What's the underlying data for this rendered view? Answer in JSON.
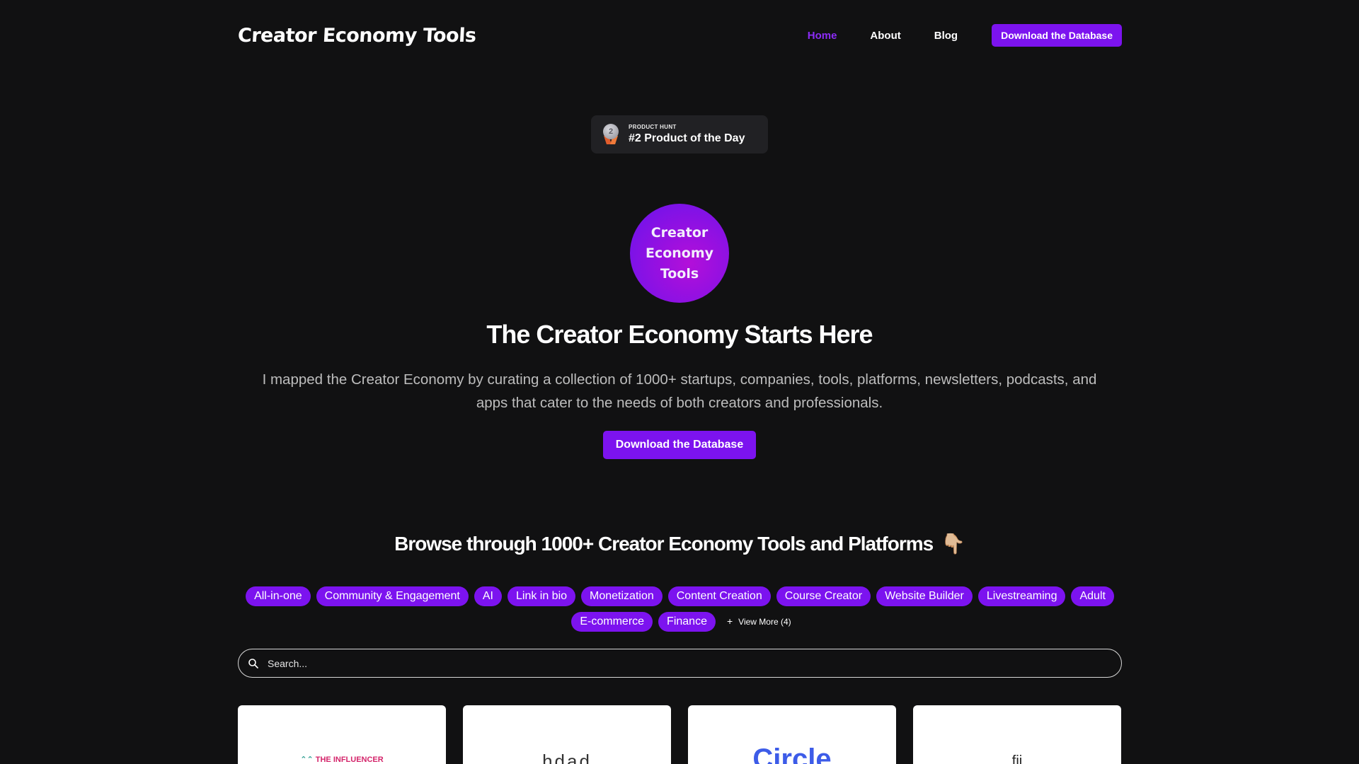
{
  "nav": {
    "logo": "Creator Economy Tools",
    "links": [
      "Home",
      "About",
      "Blog"
    ],
    "cta": "Download the Database"
  },
  "badge": {
    "medal_number": "2",
    "small": "PRODUCT HUNT",
    "big": "#2 Product of the Day"
  },
  "hero": {
    "logo_lines": [
      "Creator",
      "Economy",
      "Tools"
    ],
    "title": "The Creator Economy Starts Here",
    "subtitle": "I mapped the Creator Economy by curating a collection of 1000+ startups, companies, tools, platforms, newsletters, podcasts, and apps that cater to the needs of both creators and professionals.",
    "cta": "Download the Database"
  },
  "browse": {
    "title": "Browse through 1000+ Creator Economy Tools and Platforms",
    "emoji": "👇🏼",
    "tags": [
      "All-in-one",
      "Community & Engagement",
      "AI",
      "Link in bio",
      "Monetization",
      "Content Creation",
      "Course Creator",
      "Website Builder",
      "Livestreaming",
      "Adult",
      "E-commerce",
      "Finance"
    ],
    "view_more": "View More (4)",
    "view_more_icon": "plus-icon"
  },
  "search": {
    "placeholder": "Search...",
    "value": ""
  },
  "cards": [
    {
      "logo_text": "THE INFLUENCER"
    },
    {
      "logo_text": "hdad"
    },
    {
      "logo_text": "Circle"
    },
    {
      "logo_text": "fii"
    }
  ],
  "colors": {
    "background": "#111112",
    "accent": "#7c13ef",
    "active_link": "#8b2cf5"
  }
}
